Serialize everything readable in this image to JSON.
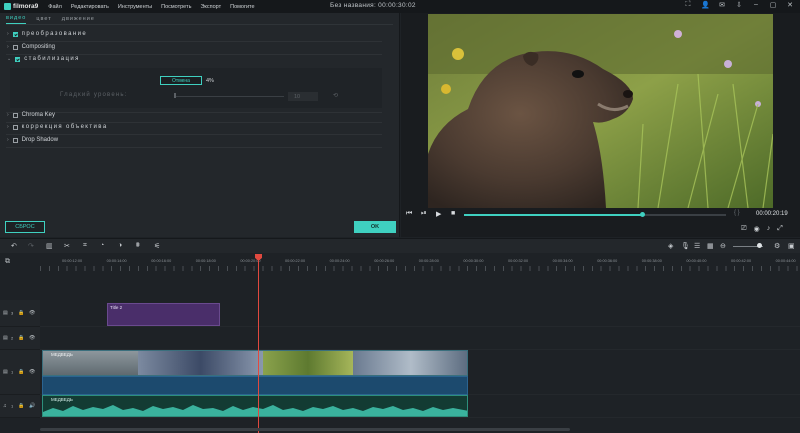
{
  "app": {
    "logo_text": "filmora9",
    "title": "Без названия: 00:00:30:02"
  },
  "menu": [
    "Файл",
    "Редактировать",
    "Инструменты",
    "Посмотреть",
    "Экспорт",
    "Помогите"
  ],
  "left_panel": {
    "tabs": [
      "видео",
      "цвет",
      "движение"
    ],
    "sections": {
      "transform": "преобразование",
      "compositing": "Compositing",
      "stabilization": "стабилизация",
      "chroma": "Chroma Key",
      "lens": "коррекция объектива",
      "shadow": "Drop Shadow"
    },
    "stab_cancel_label": "Отмена",
    "stab_percent": "4%",
    "smooth_label": "Гладкий уровень:",
    "smooth_value": "10",
    "reset_label": "СБРОС",
    "ok_label": "OK"
  },
  "preview": {
    "time": "00:00:20:19",
    "progress": 0.68
  },
  "timeline": {
    "ticks": [
      "00:00:12:00",
      "00:00:14:00",
      "00:00:16:00",
      "00:00:18:00",
      "00:00:20:00",
      "00:00:22:00",
      "00:00:24:00",
      "00:00:26:00",
      "00:00:28:00",
      "00:00:30:00",
      "00:00:32:00",
      "00:00:34:00",
      "00:00:36:00",
      "00:00:38:00",
      "00:00:40:00",
      "00:00:42:00",
      "00:00:44:00"
    ],
    "title_clip": "Title 2",
    "video_clip": "МЕДВЕДЬ",
    "audio_clip": "МЕДВЕДЬ",
    "track_labels": {
      "t3": "3",
      "t2": "2",
      "t1": "1",
      "a1": "1"
    }
  },
  "icons": {
    "undo": "undo-icon",
    "redo": "redo-icon",
    "delete": "trash-icon",
    "cut": "scissors-icon",
    "crop": "crop-icon",
    "speed": "speed-icon",
    "color": "color-icon",
    "audio": "audio-mixer-icon"
  },
  "colors": {
    "accent": "#3fd0c0",
    "playhead": "#e0493f",
    "title_clip": "#4a2e6a",
    "audio": "#2d8f7c"
  }
}
